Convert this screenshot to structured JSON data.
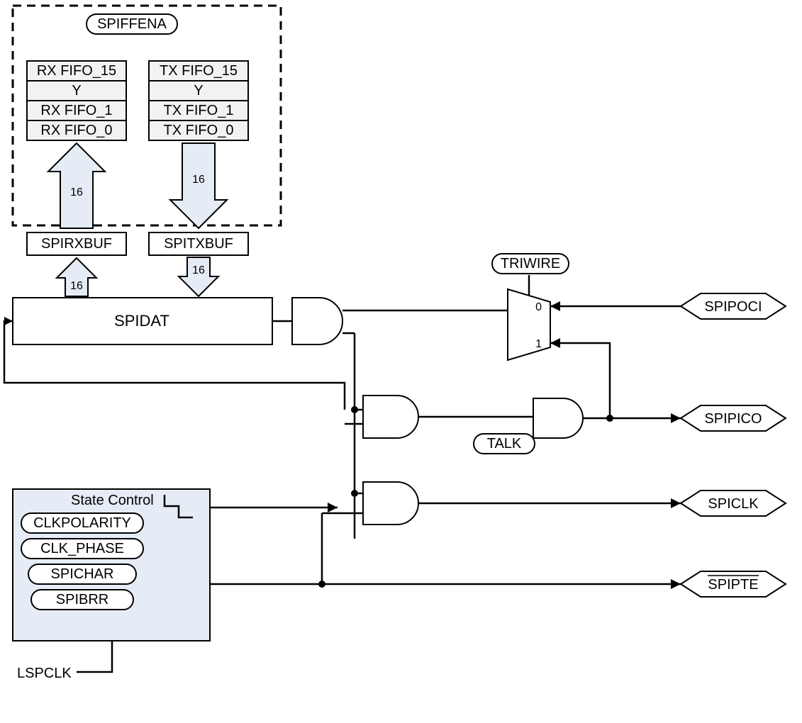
{
  "spiffena": "SPIFFENA",
  "rx": {
    "f15": "RX FIFO_15",
    "y": "Y",
    "f1": "RX FIFO_1",
    "f0": "RX FIFO_0"
  },
  "tx": {
    "f15": "TX FIFO_15",
    "y": "Y",
    "f1": "TX FIFO_1",
    "f0": "TX FIFO_0"
  },
  "spirxbuf": "SPIRXBUF",
  "spitxbuf": "SPITXBUF",
  "bus16_a": "16",
  "bus16_b": "16",
  "bus16_c": "16",
  "bus16_d": "16",
  "spidat": "SPIDAT",
  "triwire": "TRIWIRE",
  "talk": "TALK",
  "mux0": "0",
  "mux1": "1",
  "spipoci": "SPIPOCI",
  "spipico": "SPIPICO",
  "spiclk": "SPICLK",
  "spipte": "SPIPTE",
  "state_control": "State Control",
  "clkpolarity": "CLKPOLARITY",
  "clk_phase": "CLK_PHASE",
  "spichar": "SPICHAR",
  "spibrr": "SPIBRR",
  "lspclk": "LSPCLK"
}
